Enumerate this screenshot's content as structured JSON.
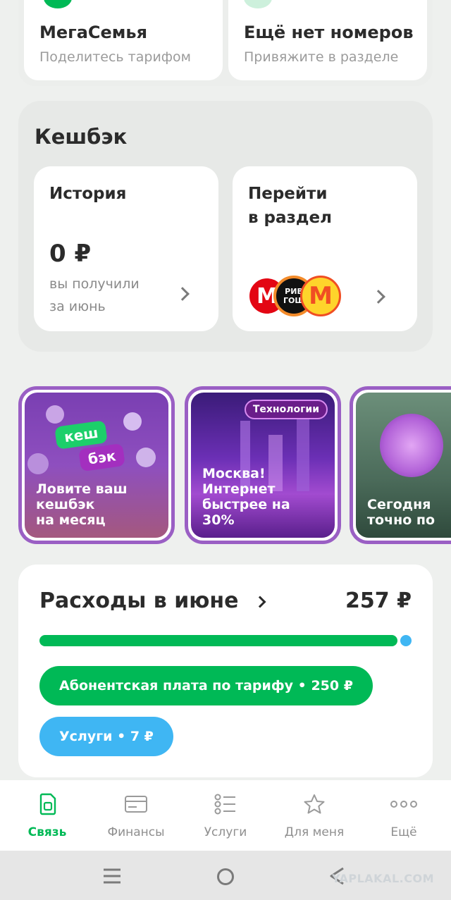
{
  "top_cards": [
    {
      "title": "МегаСемья",
      "subtitle": "Поделитесь тарифом"
    },
    {
      "title": "Ещё нет номеров",
      "subtitle": "Привяжите в разделе"
    }
  ],
  "cashback": {
    "heading": "Кешбэк",
    "history": {
      "title": "История",
      "amount": "0 ₽",
      "desc_line1": "вы получили",
      "desc_line2": "за июнь"
    },
    "goto": {
      "title_line1": "Перейти",
      "title_line2": "в раздел",
      "logos": [
        "magnit-logo",
        "rivgosh-logo",
        "yandex-market-logo"
      ],
      "logo_text": {
        "magnit": "М",
        "rivgosh_1": "РИВ",
        "rivgosh_2": "ГОШ",
        "market": "М"
      }
    }
  },
  "stories": [
    {
      "text": "Ловите ваш\nкешбэк\nна месяц",
      "sticker_1": "кеш",
      "sticker_2": "бэк"
    },
    {
      "text": "Москва!\nИнтернет\nбыстрее на\n30%",
      "tag": "Технологии"
    },
    {
      "text": "Сегодня\nточно по"
    }
  ],
  "expenses": {
    "title": "Расходы в июне",
    "total": "257 ₽",
    "segments": [
      {
        "label": "Абонентская плата по тарифу • 250 ₽",
        "value": 250,
        "color": "#00b956"
      },
      {
        "label": "Услуги • 7 ₽",
        "value": 7,
        "color": "#3fb6f3"
      }
    ]
  },
  "tabs": [
    {
      "label": "Связь",
      "icon": "sim-card-icon",
      "active": true
    },
    {
      "label": "Финансы",
      "icon": "wallet-card-icon",
      "active": false
    },
    {
      "label": "Услуги",
      "icon": "list-icon",
      "active": false
    },
    {
      "label": "Для меня",
      "icon": "star-icon",
      "active": false
    },
    {
      "label": "Ещё",
      "icon": "more-dots-icon",
      "active": false
    }
  ],
  "system_nav": {
    "icons": [
      "menu-icon",
      "home-icon",
      "back-icon"
    ],
    "watermark": "YAPLAKAL.COM"
  },
  "colors": {
    "accent": "#00b956",
    "services": "#3fb6f3",
    "story_border": "#9a5fc4"
  }
}
